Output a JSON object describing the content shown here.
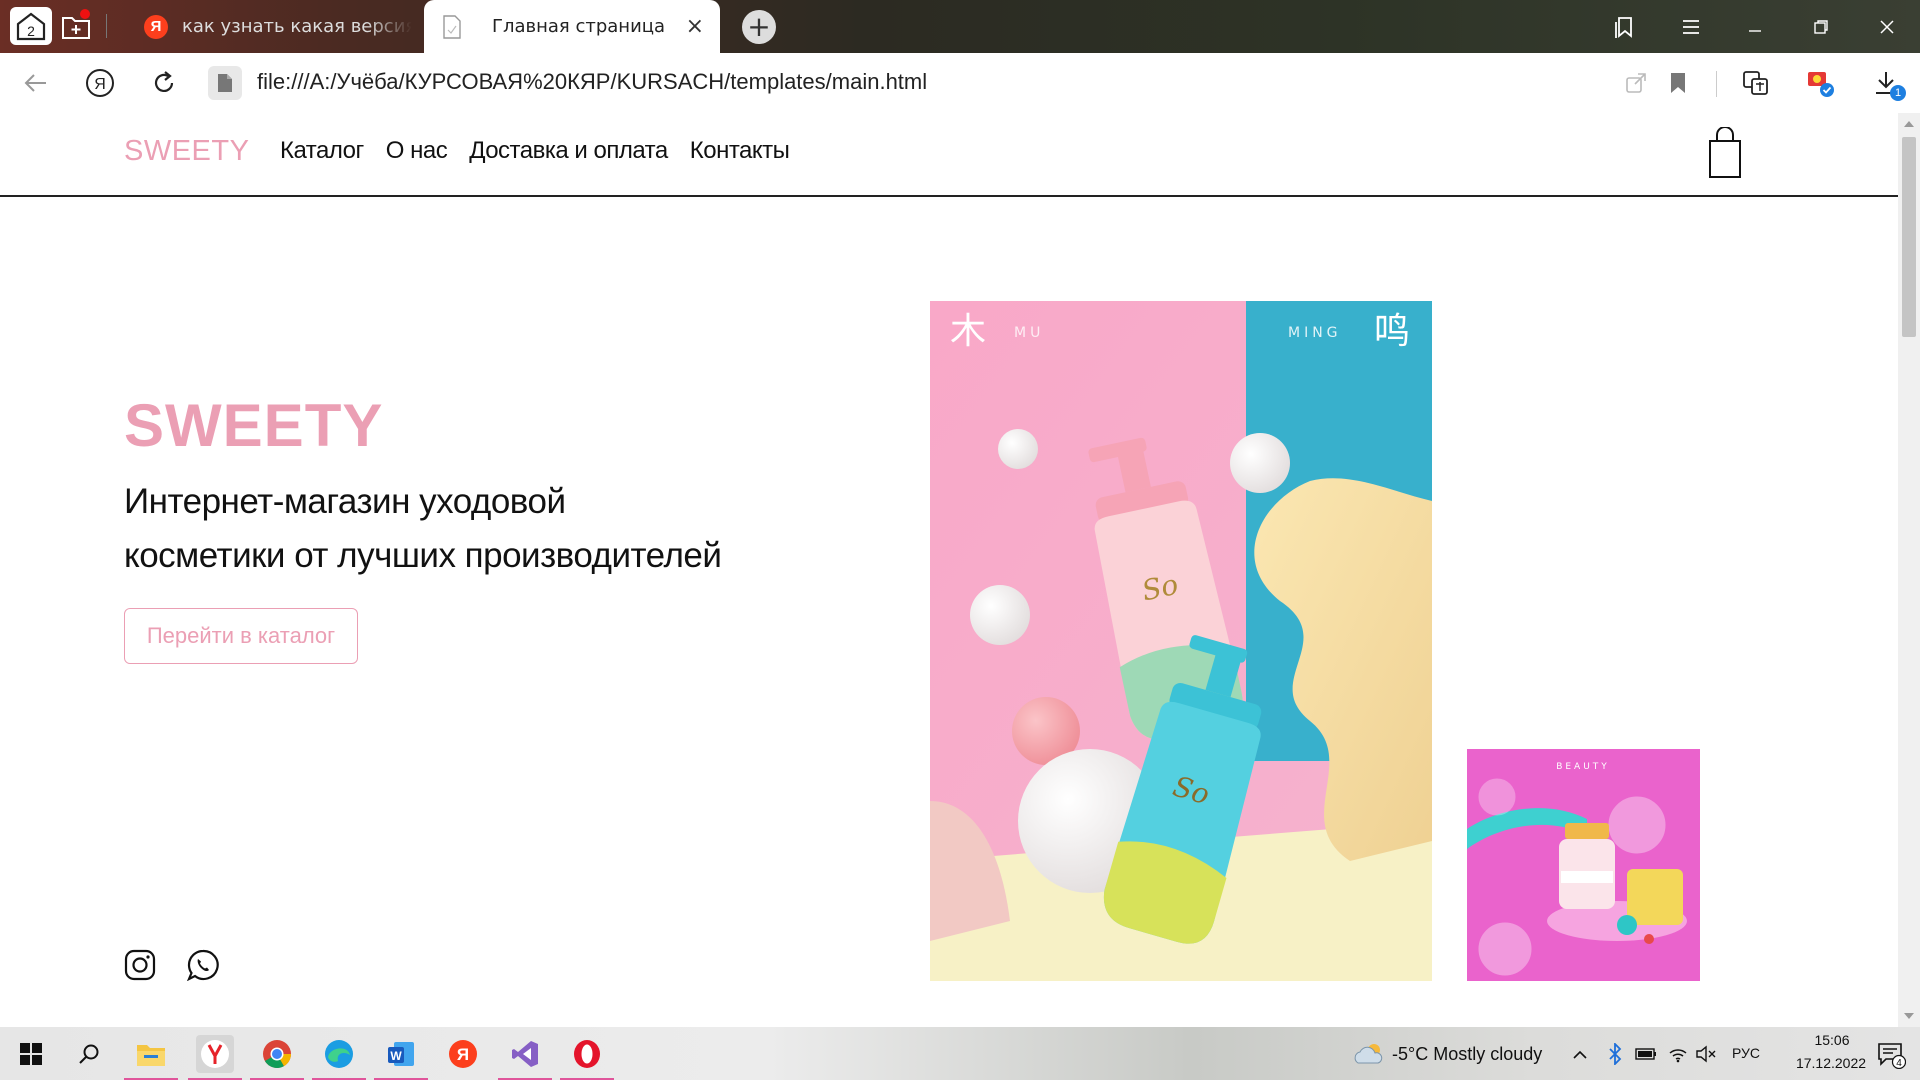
{
  "browser": {
    "tabs_count": "2",
    "tabs": [
      {
        "title": "как узнать какая версия б",
        "active": false
      },
      {
        "title": "Главная страница",
        "active": true
      }
    ],
    "close_symbol": "×",
    "new_tab_symbol": "+",
    "url": "file:///A:/Учёба/КУРСОВАЯ%20КЯР/KURSACH/templates/main.html",
    "downloads_badge": "1"
  },
  "site": {
    "logo": "SWEETY",
    "nav": [
      "Каталог",
      "О нас",
      "Доставка и оплата",
      "Контакты"
    ],
    "hero": {
      "title": "SWEETY",
      "subtitle_line1": "Интернет-магазин уходовой",
      "subtitle_line2": "косметики от лучших производителей",
      "cta": "Перейти в каталог"
    },
    "brand_color": "#eb9fb4",
    "image_main": {
      "left_char": "木",
      "left_word": "MU",
      "right_word": "MING",
      "right_char": "鸣"
    },
    "image_small": {
      "caption": "BEAUTY"
    }
  },
  "taskbar": {
    "weather": "-5°C  Mostly cloudy",
    "lang": "РУС",
    "time": "15:06",
    "date": "17.12.2022",
    "notifications": "4"
  }
}
